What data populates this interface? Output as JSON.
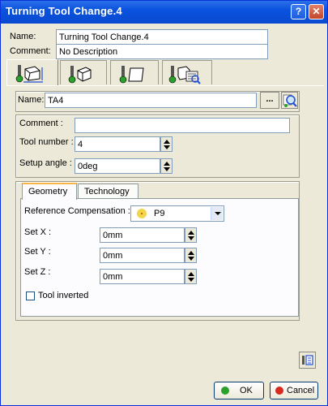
{
  "window": {
    "title": "Turning Tool Change.4",
    "help_glyph": "?",
    "close_glyph": "✕"
  },
  "header": {
    "name_label": "Name:",
    "name_value": "Turning Tool Change.4",
    "comment_label": "Comment:",
    "comment_value": "No Description"
  },
  "icon_tabs": [
    {
      "icon": "tool-assembly-icon"
    },
    {
      "icon": "tool-geometry-icon"
    },
    {
      "icon": "tool-insert-icon"
    },
    {
      "icon": "tool-catalog-icon"
    }
  ],
  "tool": {
    "name_label": "Name:",
    "name_value": "TA4",
    "browse_label": "...",
    "comment_label": "Comment :",
    "comment_value": "",
    "tool_number_label": "Tool number :",
    "tool_number_value": "4",
    "setup_angle_label": "Setup angle :",
    "setup_angle_value": "0deg"
  },
  "tabs": [
    {
      "label": "Geometry"
    },
    {
      "label": "Technology"
    }
  ],
  "geometry": {
    "ref_comp_label": "Reference Compensation :",
    "ref_comp_value": "P9",
    "set_x_label": "Set X :",
    "set_x_value": "0mm",
    "set_y_label": "Set Y :",
    "set_y_value": "0mm",
    "set_z_label": "Set Z :",
    "set_z_value": "0mm",
    "tool_inverted_label": "Tool inverted"
  },
  "footer": {
    "ok_label": "OK",
    "cancel_label": "Cancel"
  },
  "colors": {
    "title_bar": "#0a52de",
    "ok_dot": "#2aa12a",
    "cancel_dot": "#d62b1e",
    "ref_dot": "#f4d44a"
  }
}
